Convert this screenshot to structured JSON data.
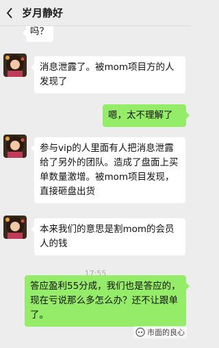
{
  "header": {
    "title": "岁月静好"
  },
  "messages": [
    {
      "text": "吗？"
    },
    {
      "text": "消息泄露了。被mom项目方的人发现了"
    },
    {
      "text": "嗯，太不理解了"
    },
    {
      "text": "参与vip的人里面有人把消息泄露给了另外的团队。造成了盘面上买单数量激增。被mom项目发现，直接砸盘出货"
    },
    {
      "text": "本来我们的意思是割mom的会员人的钱"
    },
    {
      "text": "答应盈利55分成，我们也是答应的，现在亏说那么多怎么办？还不让跟单了。"
    }
  ],
  "timestamp": "17:55",
  "watermark": {
    "text": "市面的良心",
    "icon": "wechat-channel-icon"
  },
  "colors": {
    "sent": "#95ec69",
    "received": "#ffffff",
    "background": "#ededed"
  }
}
